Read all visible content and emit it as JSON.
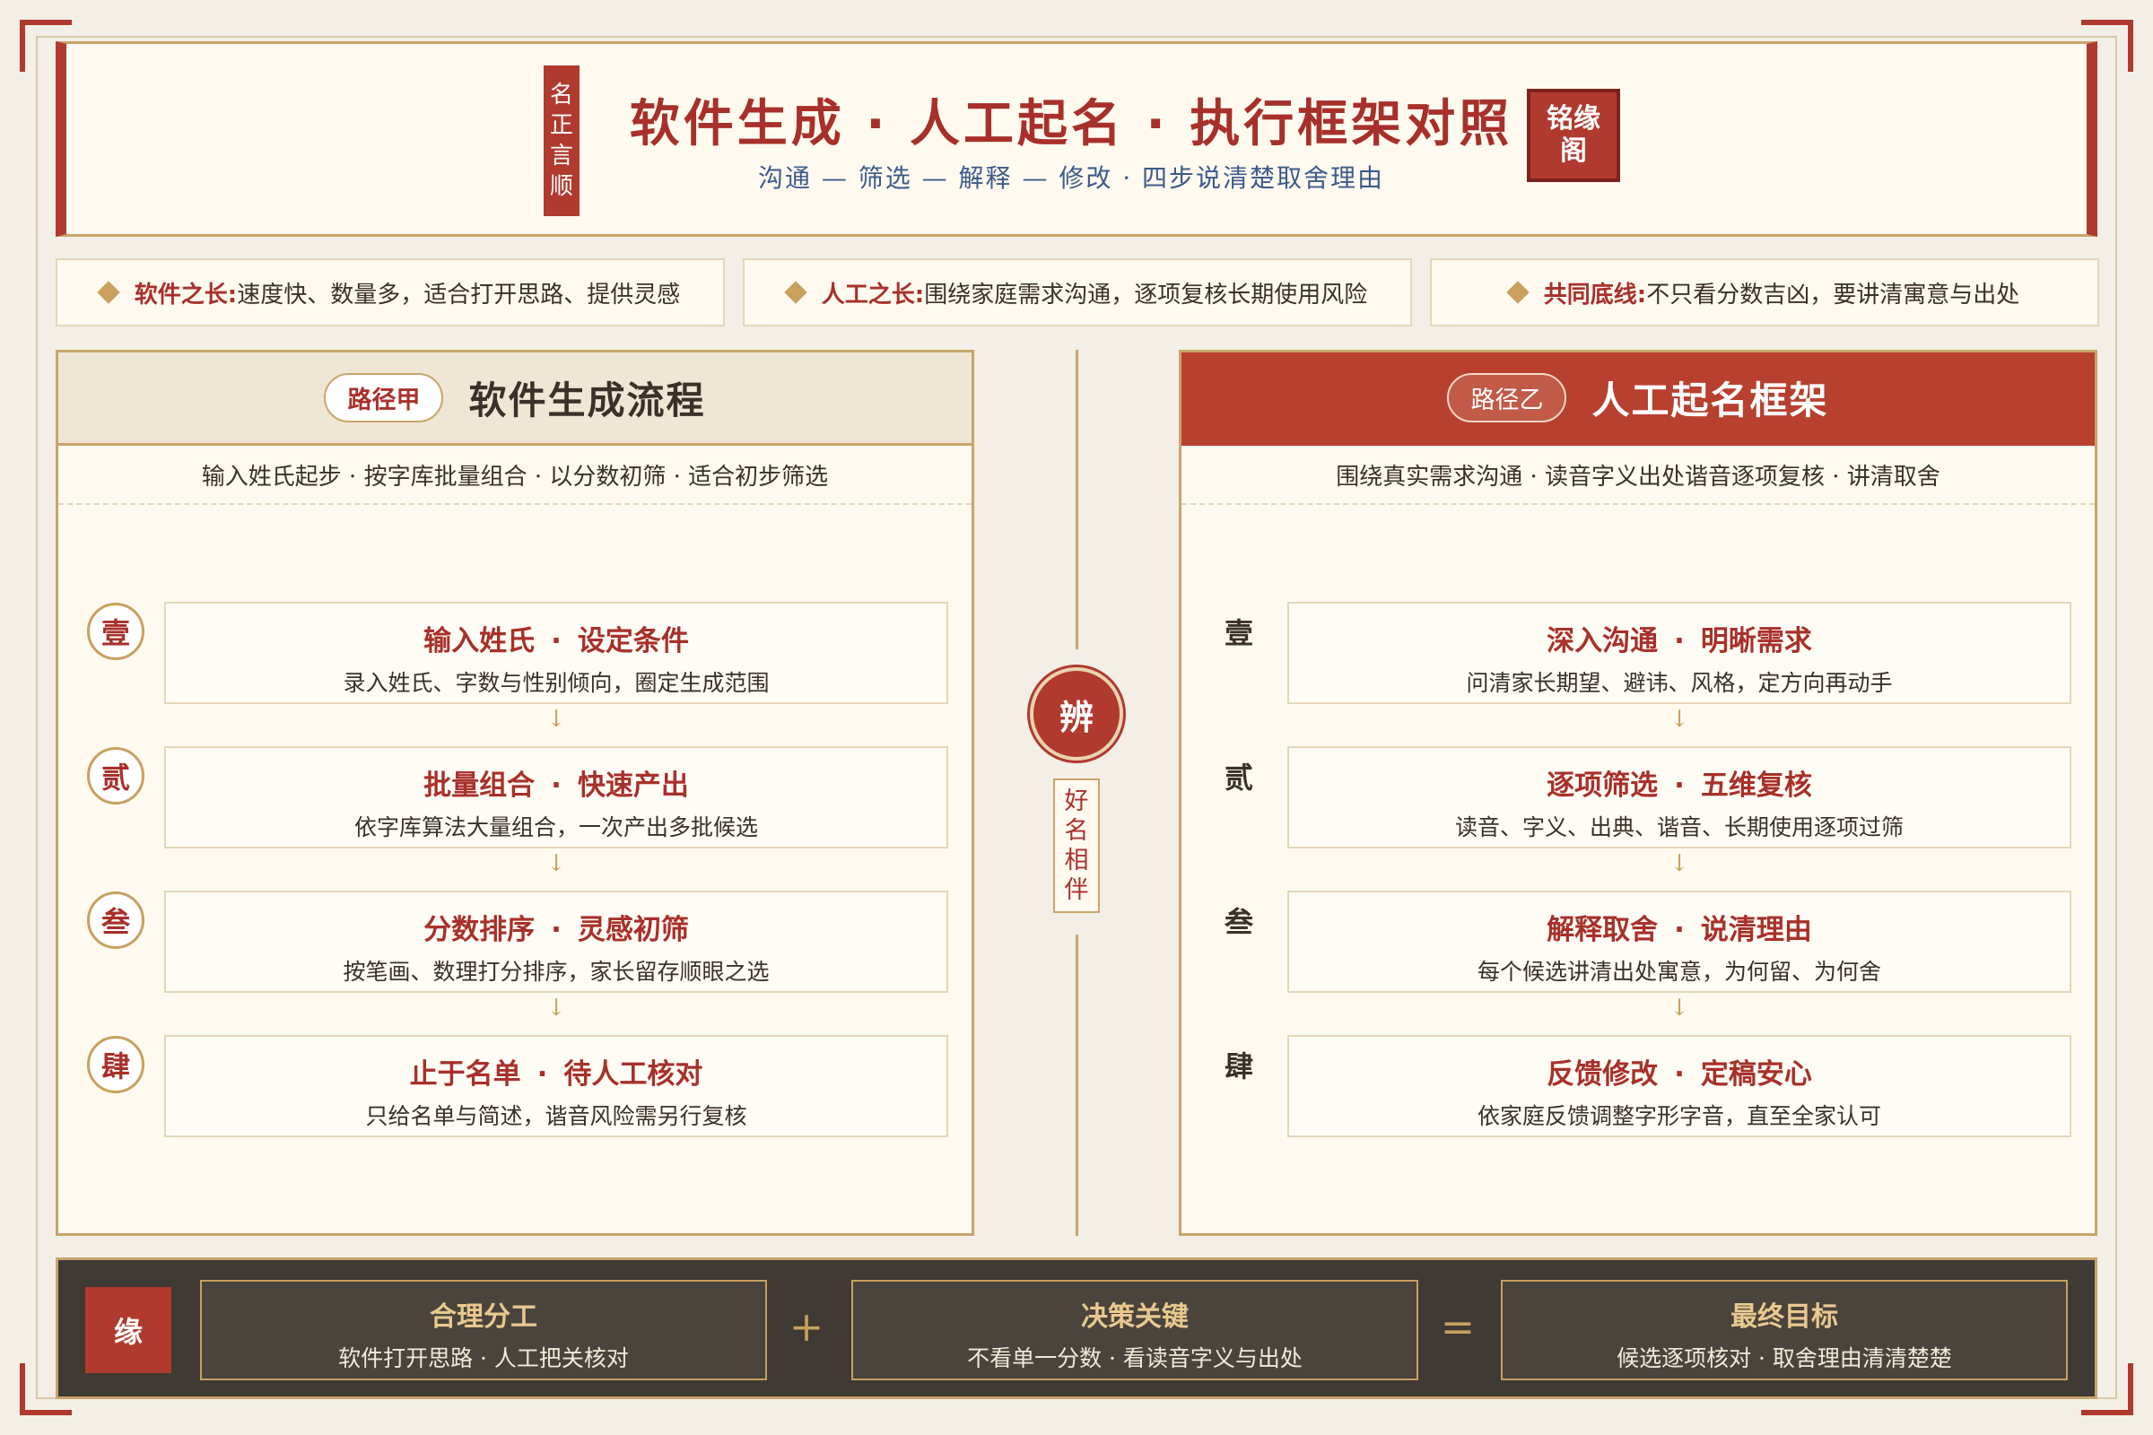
{
  "header": {
    "seal_vertical": [
      "名",
      "正",
      "言",
      "顺"
    ],
    "title": "软件生成 · 人工起名 · 执行框架对照",
    "subtitle": "沟通 — 筛选 — 解释 — 修改 · 四步说清楚取舍理由",
    "seal_square": [
      "铭缘",
      "阁"
    ]
  },
  "info_cards": [
    {
      "key": "软件之长:",
      "value": "速度快、数量多，适合打开思路、提供灵感"
    },
    {
      "key": "人工之长:",
      "value": "围绕家庭需求沟通，逐项复核长期使用风险"
    },
    {
      "key": "共同底线:",
      "value": "不只看分数吉凶，要讲清寓意与出处"
    }
  ],
  "left_panel": {
    "tag": "路径甲",
    "title": "软件生成流程",
    "desc": "输入姓氏起步 · 按字库批量组合 · 以分数初筛 · 适合初步筛选",
    "steps": [
      {
        "num": "壹",
        "title_a": "输入姓氏",
        "title_b": "设定条件",
        "desc": "录入姓氏、字数与性别倾向，圈定生成范围"
      },
      {
        "num": "贰",
        "title_a": "批量组合",
        "title_b": "快速产出",
        "desc": "依字库算法大量组合，一次产出多批候选"
      },
      {
        "num": "叁",
        "title_a": "分数排序",
        "title_b": "灵感初筛",
        "desc": "按笔画、数理打分排序，家长留存顺眼之选"
      },
      {
        "num": "肆",
        "title_a": "止于名单",
        "title_b": "待人工核对",
        "desc": "只给名单与简述，谐音风险需另行复核"
      }
    ]
  },
  "right_panel": {
    "tag": "路径乙",
    "title": "人工起名框架",
    "desc": "围绕真实需求沟通 · 读音字义出处谐音逐项复核 · 讲清取舍",
    "steps": [
      {
        "num": "壹",
        "title_a": "深入沟通",
        "title_b": "明晰需求",
        "desc": "问清家长期望、避讳、风格，定方向再动手"
      },
      {
        "num": "贰",
        "title_a": "逐项筛选",
        "title_b": "五维复核",
        "desc": "读音、字义、出典、谐音、长期使用逐项过筛"
      },
      {
        "num": "叁",
        "title_a": "解释取舍",
        "title_b": "说清理由",
        "desc": "每个候选讲清出处寓意，为何留、为何舍"
      },
      {
        "num": "肆",
        "title_a": "反馈修改",
        "title_b": "定稿安心",
        "desc": "依家庭反馈调整字形字音，直至全家认可"
      }
    ]
  },
  "center": {
    "circle": "辨",
    "tag": [
      "好",
      "名",
      "相",
      "伴"
    ]
  },
  "footer": {
    "seal": "缘",
    "boxes": [
      {
        "title": "合理分工",
        "desc": "软件打开思路 · 人工把关核对"
      },
      {
        "title": "决策关键",
        "desc": "不看单一分数 · 看读音字义与出处"
      },
      {
        "title": "最终目标",
        "desc": "候选逐项核对 · 取舍理由清清楚楚"
      }
    ],
    "ops": [
      "+",
      "="
    ]
  },
  "colors": {
    "accent_red": "#b03a2e",
    "gold": "#c9a46a",
    "paper": "#fffaf0",
    "dark": "#3f3a33"
  }
}
